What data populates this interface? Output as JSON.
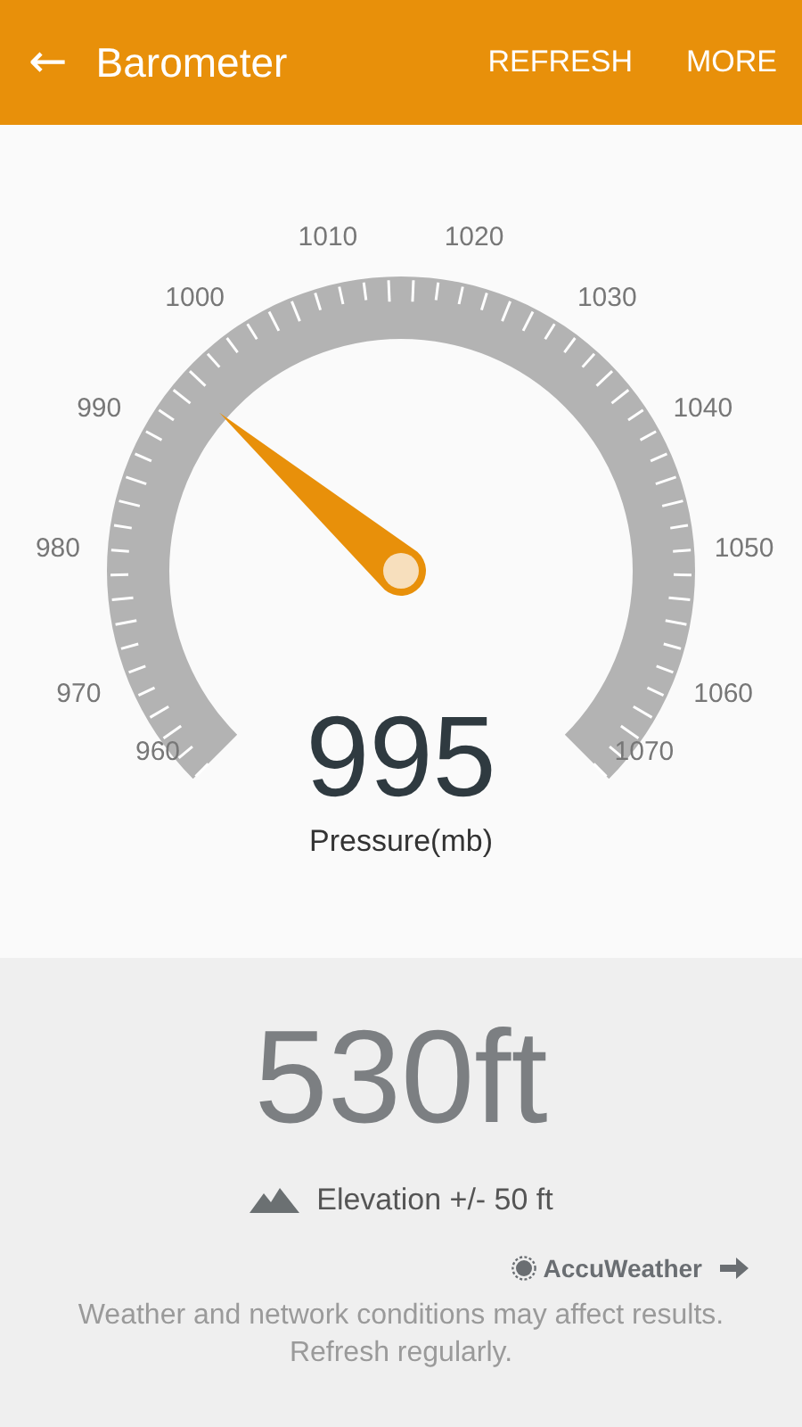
{
  "app_bar": {
    "back": "←",
    "title": "Barometer",
    "actions": [
      "REFRESH",
      "MORE"
    ]
  },
  "gauge": {
    "tick_labels": [
      "960",
      "970",
      "980",
      "990",
      "1000",
      "1010",
      "1020",
      "1030",
      "1040",
      "1050",
      "1060",
      "1070"
    ],
    "reading": "995",
    "unit": "Pressure(mb)"
  },
  "elevation": {
    "value": "530ft",
    "accuracy": "Elevation +/- 50 ft"
  },
  "provider": {
    "name": "AccuWeather"
  },
  "disclaimer": "Weather and network conditions may affect results. Refresh regularly."
}
